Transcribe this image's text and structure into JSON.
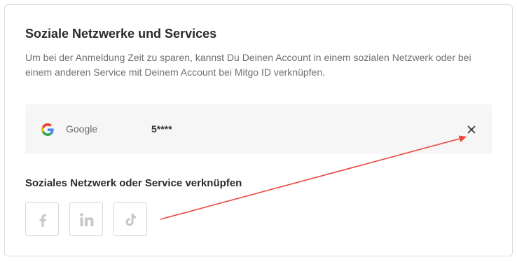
{
  "section": {
    "title": "Soziale Netzwerke und Services",
    "description": "Um bei der Anmeldung Zeit zu sparen, kannst Du Deinen Account in einem sozialen Netzwerk oder bei einem anderen Service mit Deinem Account bei Mitgo ID verknüpfen."
  },
  "linked_accounts": [
    {
      "provider": "Google",
      "icon": "google-icon",
      "account_id": "5****",
      "action_icon": "close-icon"
    }
  ],
  "connect": {
    "title": "Soziales Netzwerk oder Service verknüpfen",
    "buttons": [
      {
        "icon": "facebook-icon"
      },
      {
        "icon": "linkedin-icon"
      },
      {
        "icon": "tiktok-icon"
      }
    ]
  },
  "colors": {
    "annotation_arrow": "#e8473f",
    "linked_row_bg": "#f6f6f6",
    "social_icon": "#c8c8c8"
  }
}
